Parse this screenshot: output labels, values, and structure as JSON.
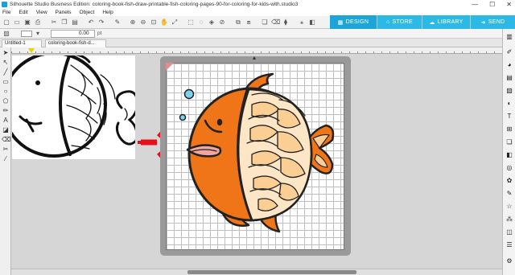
{
  "window": {
    "title": "Silhouette Studio Business Edition: coloring-book-fish-draw-printable-fish-coloring-pages-90-for-coloring-for-kids-with.studio3",
    "minimize": "—",
    "maximize": "☐",
    "close": "✕"
  },
  "menu": [
    "File",
    "Edit",
    "View",
    "Panels",
    "Object",
    "Help"
  ],
  "nav_tabs": [
    {
      "label": "DESIGN",
      "icon": "grid-icon",
      "color": "#1fa4d8"
    },
    {
      "label": "STORE",
      "icon": "store-icon",
      "color": "#2cb9e6"
    },
    {
      "label": "LIBRARY",
      "icon": "library-icon",
      "color": "#2cb9e6"
    },
    {
      "label": "SEND",
      "icon": "send-icon",
      "color": "#2cb9e6"
    }
  ],
  "line_width": {
    "value": "0.00",
    "unit": "pt"
  },
  "doc_tabs": [
    "Untitled-1",
    "coloring-book-fish-d..."
  ],
  "colors": {
    "accent": "#1fa4d8",
    "arrow_red": "#e6101a",
    "fish_orange": "#f07418",
    "fish_light": "#fbcf94",
    "fish_pale": "#fde6c6",
    "bubble": "#7fd0ee"
  }
}
